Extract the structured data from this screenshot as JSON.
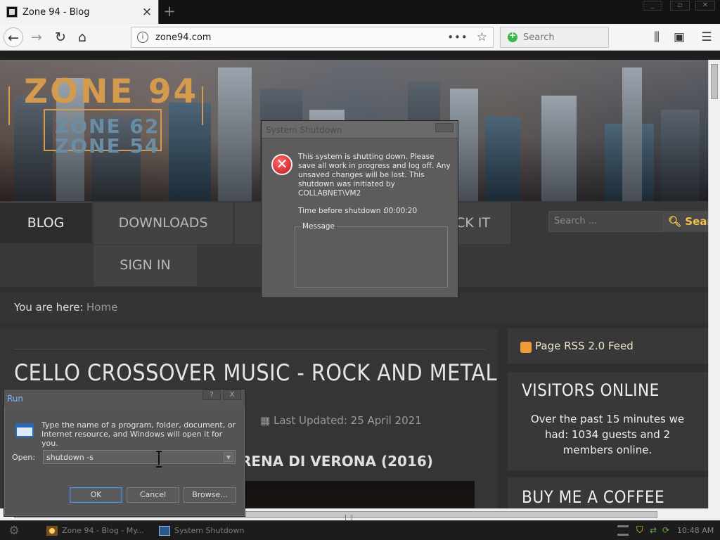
{
  "browser": {
    "tab_title": "Zone 94 - Blog",
    "tab_close": "×",
    "new_tab": "+",
    "url": "zone94.com",
    "search_placeholder": "Search",
    "page_actions": "•••"
  },
  "site": {
    "logo_main": "ZONE 94",
    "logo_sub1": "ZONE 62",
    "logo_sub2": "ZONE 54",
    "menu": [
      {
        "label": "BLOG"
      },
      {
        "label": "DOWNLOADS"
      },
      {
        "label": "CK IT"
      },
      {
        "label": "SIGN IN"
      }
    ],
    "search_placeholder": "Search ...",
    "search_button": "Search",
    "breadcrumb_label": "You are here:",
    "breadcrumb_home": "Home"
  },
  "article": {
    "title": "CELLO CROSSOVER MUSIC - ROCK AND METAL",
    "updated": "Last Updated: 25 April 2021",
    "subtitle": "RENA DI VERONA (2016)"
  },
  "sidebar": {
    "rss_label": "Page RSS 2.0 Feed",
    "visitors_title": "VISITORS ONLINE",
    "visitors_text": "Over the past 15 minutes we had: 1034 guests and 2 members online.",
    "coffee_title": "BUY ME A COFFEE"
  },
  "shutdown_dialog": {
    "title": "System Shutdown",
    "message": "This system is shutting down. Please save all work in progress and log off. Any unsaved changes will be lost. This shutdown was initiated by COLLABNET\\VM2",
    "time_label": "Time before shutdown :",
    "time_value": "00:00:20",
    "message_box_label": "Message"
  },
  "run_dialog": {
    "title": "Run",
    "help": "?",
    "close": "X",
    "instructions": "Type the name of a program, folder, document, or Internet resource, and Windows will open it for you.",
    "open_label": "Open:",
    "command_value": "shutdown -s",
    "ok": "OK",
    "cancel": "Cancel",
    "browse": "Browse..."
  },
  "taskbar": {
    "items": [
      {
        "label": "Zone 94 - Blog - My..."
      },
      {
        "label": "System Shutdown"
      }
    ],
    "clock": "10:48 AM"
  },
  "icons": {
    "back": "back-arrow-icon",
    "forward": "forward-arrow-icon",
    "reload": "reload-icon",
    "home": "home-icon",
    "bookmark": "star-icon",
    "library": "library-icon",
    "sidebar": "sidebar-icon",
    "menu": "hamburger-menu-icon",
    "error": "error-x-icon",
    "rss": "rss-icon",
    "calendar": "calendar-icon"
  },
  "colors": {
    "accent_gold": "#f2c14e",
    "logo_orange": "#d49a4e",
    "error_red": "#c4141a",
    "run_title_blue": "#78b4ff"
  }
}
